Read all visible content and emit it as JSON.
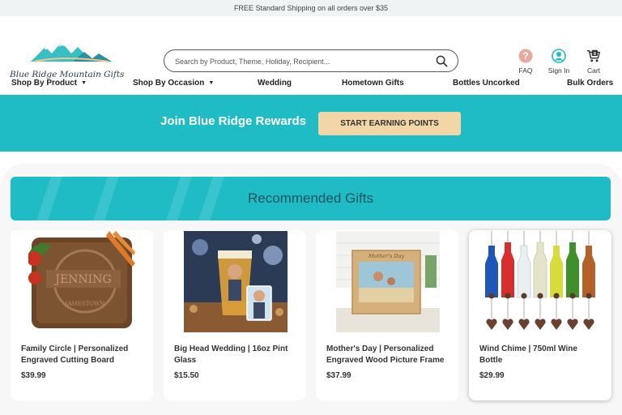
{
  "announcement": "FREE Standard Shipping on all orders over $35",
  "brand": {
    "name": "Blue Ridge Mountain Gifts"
  },
  "search": {
    "placeholder": "Search by Product, Theme, Holiday, Recipient...",
    "icon": "search-icon"
  },
  "header_icons": [
    {
      "label": "FAQ",
      "icon": "question-icon",
      "color": "#e9a89c"
    },
    {
      "label": "Sign In",
      "icon": "user-icon",
      "color": "#1fbcc6"
    },
    {
      "label": "Cart",
      "icon": "cart-icon",
      "count": "0"
    }
  ],
  "nav": [
    {
      "label": "Shop By Product",
      "dropdown": true
    },
    {
      "label": "Shop By Occasion",
      "dropdown": true
    },
    {
      "label": "Wedding",
      "dropdown": false
    },
    {
      "label": "Hometown Gifts",
      "dropdown": false
    },
    {
      "label": "Bottles Uncorked",
      "dropdown": false
    },
    {
      "label": "Bulk Orders",
      "dropdown": false
    }
  ],
  "rewards": {
    "title": "Join Blue Ridge Rewards",
    "button": "START EARNING POINTS"
  },
  "recommended": {
    "title": "Recommended Gifts",
    "products": [
      {
        "name": "Family Circle | Personalized Engraved Cutting Board",
        "price": "$39.99"
      },
      {
        "name": "Big Head Wedding | 16oz Pint Glass",
        "price": "$15.50"
      },
      {
        "name": "Mother's Day | Personalized Engraved Wood Picture Frame",
        "price": "$37.99"
      },
      {
        "name": "Wind Chime | 750ml Wine Bottle",
        "price": "$29.99"
      }
    ]
  },
  "colors": {
    "accent": "#1fbcc6",
    "button": "#f3d6a7",
    "title_text": "#1d5560"
  }
}
